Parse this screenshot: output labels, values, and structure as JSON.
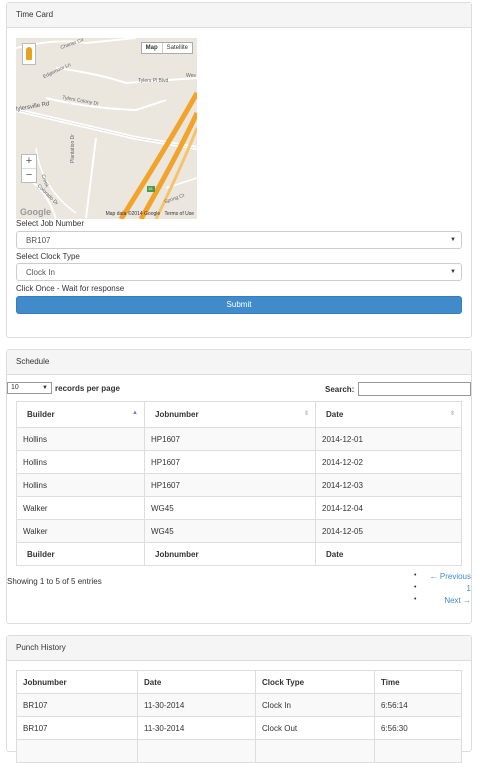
{
  "timecard": {
    "heading": "Time Card",
    "map": {
      "toggle_map": "Map",
      "toggle_satellite": "Satellite",
      "attribution": "Map data ©2014 Google",
      "terms": "Terms of Use",
      "logo": "Google",
      "zoom_in": "+",
      "zoom_out": "−",
      "street_labels": [
        "Charter Cir",
        "Edgemoor Ln",
        "Tylers Pl Blvd",
        "Wes",
        "Tylers Colony Dr",
        "Plantation Dr",
        "Creek",
        "Colorado Dr",
        "Spring Ct",
        "lylersville Rd"
      ],
      "route_shield": "15"
    },
    "job_label": "Select Job Number",
    "job_value": "BR107",
    "clock_label": "Select Clock Type",
    "clock_value": "Clock In",
    "note": "Click Once - Wait for response",
    "submit": "Submit"
  },
  "schedule": {
    "heading": "Schedule",
    "length_value": "10",
    "length_label": "records per page",
    "search_label": "Search:",
    "columns": [
      "Builder",
      "Jobnumber",
      "Date"
    ],
    "rows": [
      [
        "Hollins",
        "HP1607",
        "2014-12-01"
      ],
      [
        "Hollins",
        "HP1607",
        "2014-12-02"
      ],
      [
        "Hollins",
        "HP1607",
        "2014-12-03"
      ],
      [
        "Walker",
        "WG45",
        "2014-12-04"
      ],
      [
        "Walker",
        "WG45",
        "2014-12-05"
      ]
    ],
    "info": "Showing 1 to 5 of 5 entries",
    "prev": "← Previous",
    "page": "1",
    "next": "Next →"
  },
  "punch_history": {
    "heading": "Punch History",
    "columns": [
      "Jobnumber",
      "Date",
      "Clock Type",
      "Time"
    ],
    "rows": [
      [
        "BR107",
        "11-30-2014",
        "Clock In",
        "6:56:14"
      ],
      [
        "BR107",
        "11-30-2014",
        "Clock Out",
        "6:56:30"
      ],
      [
        "",
        "",
        "",
        ""
      ]
    ]
  },
  "colors": {
    "primary_button": "#428bca",
    "panel_heading_bg": "#f5f5f5",
    "map_highway": "#f2a32a"
  }
}
